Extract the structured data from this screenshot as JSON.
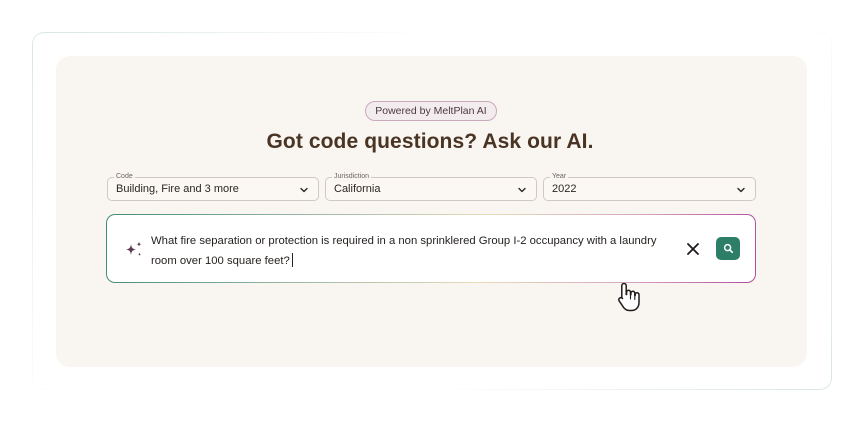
{
  "badge": {
    "label": "Powered by MeltPlan AI"
  },
  "heading": {
    "title": "Got code questions? Ask our AI."
  },
  "filters": {
    "code": {
      "legend": "Code",
      "value": "Building, Fire and 3 more"
    },
    "jurisdiction": {
      "legend": "Jurisdiction",
      "value": "California"
    },
    "year": {
      "legend": "Year",
      "value": "2022"
    }
  },
  "query": {
    "text": "What fire separation or protection is required in a non sprinklered Group I-2 occupancy with a laundry room over 100 square feet?"
  },
  "icons": {
    "sparkle": "sparkle-icon",
    "clear": "close-icon",
    "search": "search-icon",
    "dropdown": "chevron-down-icon",
    "cursor": "hand-pointer-icon"
  },
  "colors": {
    "card_background": "#f9f5f0",
    "heading": "#4a3424",
    "accent_green": "#2c7e67",
    "accent_magenta": "#b04aa0",
    "sparkle": "#5b3b52"
  }
}
